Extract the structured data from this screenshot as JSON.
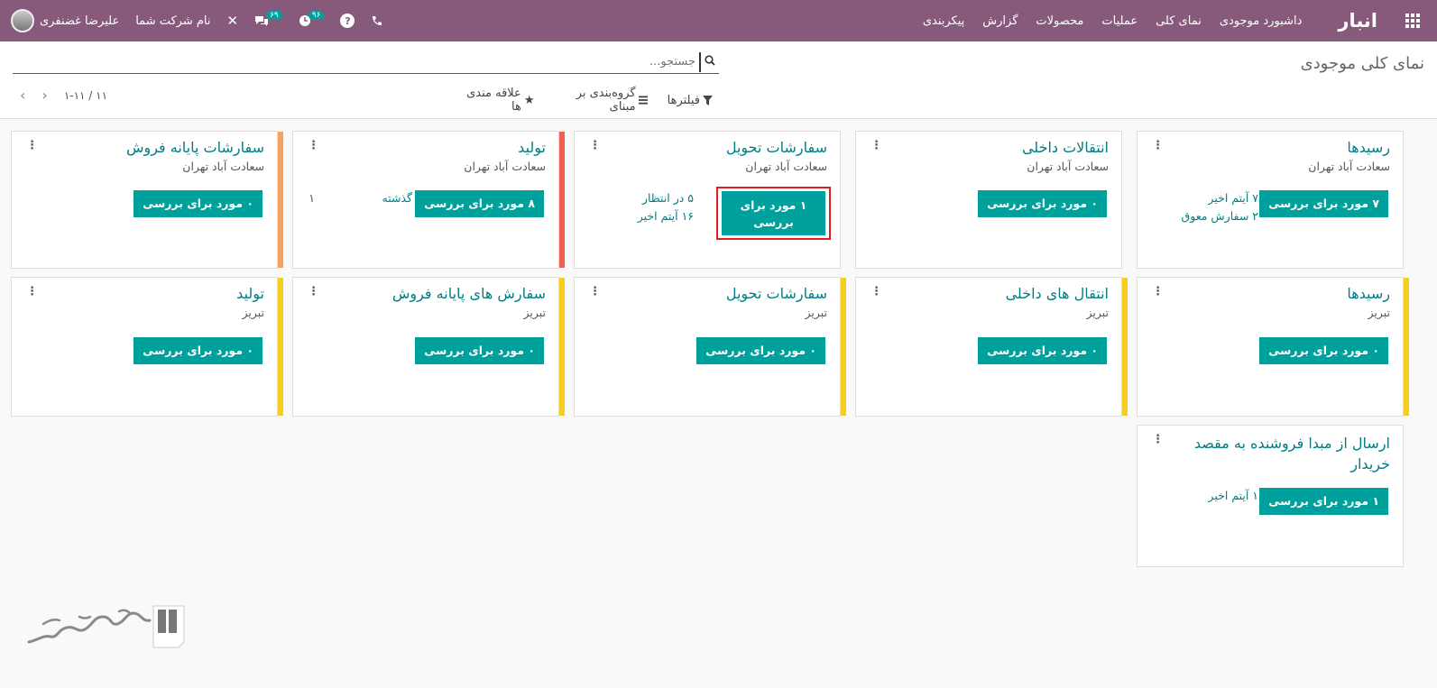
{
  "navbar": {
    "brand": "انبار",
    "menu": [
      "داشبورد موجودی",
      "نمای کلی",
      "عملیات",
      "محصولات",
      "گزارش",
      "پیکربندی"
    ],
    "user_name": "علیرضا غضنفری",
    "company": "نام شرکت شما",
    "messages_count": "۶۹",
    "activities_count": "۹۶",
    "help": "?"
  },
  "control": {
    "page_title": "نمای کلی موجودی",
    "search_placeholder": "جستجو...",
    "filters_label": "فیلترها",
    "groupby_label": "گروه‌بندی بر مبنای",
    "favorites_label": "علاقه مندی ها",
    "pager_text": "۱-۱۱ / ۱۱"
  },
  "cards": [
    {
      "title": "رسیدها",
      "warehouse": "سعادت آباد تهران",
      "button": "۷ مورد برای بررسی",
      "stats": [
        "۷ آیتم اخیر",
        "۲ سفارش معوق"
      ],
      "stripe": ""
    },
    {
      "title": "انتقالات داخلی",
      "warehouse": "سعادت آباد تهران",
      "button": "۰ مورد برای بررسی",
      "stats": [],
      "stripe": ""
    },
    {
      "title": "سفارشات تحویل",
      "warehouse": "سعادت آباد تهران",
      "button_line1": "۱ مورد برای",
      "button_line2": "بررسی",
      "stats": [
        "۵ در انتظار",
        "۱۶ آیتم اخیر"
      ],
      "stripe": ""
    },
    {
      "title": "تولید",
      "warehouse": "سعادت آباد تهران",
      "button": "۸ مورد برای بررسی",
      "stats": [
        "گذشته",
        "۱"
      ],
      "stripe": "#f06050"
    },
    {
      "title": "سفارشات پایانه فروش",
      "warehouse": "سعادت آباد تهران",
      "button": "۰ مورد برای بررسی",
      "stats": [],
      "stripe": "#f4a460"
    },
    {
      "title": "رسیدها",
      "warehouse": "تبریز",
      "button": "۰ مورد برای بررسی",
      "stats": [],
      "stripe": "#f7cd1f"
    },
    {
      "title": "انتقال های داخلی",
      "warehouse": "تبریز",
      "button": "۰ مورد برای بررسی",
      "stats": [],
      "stripe": "#f7cd1f"
    },
    {
      "title": "سفارشات تحویل",
      "warehouse": "تبریز",
      "button": "۰ مورد برای بررسی",
      "stats": [],
      "stripe": "#f7cd1f"
    },
    {
      "title": "سفارش های پایانه فروش",
      "warehouse": "تبریز",
      "button": "۰ مورد برای بررسی",
      "stats": [],
      "stripe": "#f7cd1f"
    },
    {
      "title": "تولید",
      "warehouse": "تبریز",
      "button": "۰ مورد برای بررسی",
      "stats": [],
      "stripe": "#f7cd1f"
    },
    {
      "title": "ارسال از مبدا فروشنده به مقصد خریدار",
      "warehouse": "",
      "button": "۱ مورد برای بررسی",
      "stats": [
        "۱ آیتم اخیر"
      ],
      "stripe": ""
    }
  ],
  "colors": {
    "navbar": "#875a7b",
    "accent": "#00a09d",
    "title": "#017e84",
    "highlight": "#e02020"
  }
}
